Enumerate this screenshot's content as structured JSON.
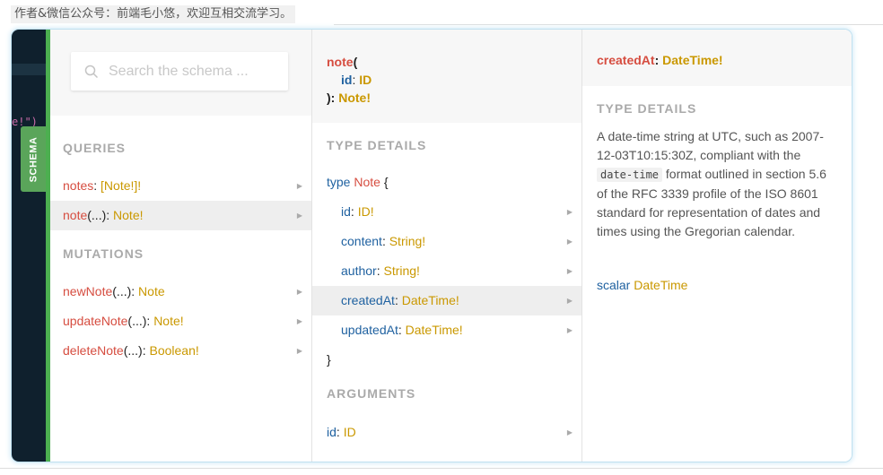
{
  "caption": "作者&微信公众号：前端毛小悠，欢迎互相交流学习。",
  "editor": {
    "code_fragment": "e!\")"
  },
  "schema_tab": "SCHEMA",
  "search": {
    "placeholder": "Search the schema ..."
  },
  "explorer": {
    "queries_title": "QUERIES",
    "queries": [
      {
        "name": "notes",
        "args": "",
        "sep": ": ",
        "type": "[Note!]!"
      },
      {
        "name": "note",
        "args": "(...)",
        "sep": ": ",
        "type": "Note!"
      }
    ],
    "mutations_title": "MUTATIONS",
    "mutations": [
      {
        "name": "newNote",
        "args": "(...)",
        "sep": ": ",
        "type": "Note"
      },
      {
        "name": "updateNote",
        "args": "(...)",
        "sep": ": ",
        "type": "Note!"
      },
      {
        "name": "deleteNote",
        "args": "(...)",
        "sep": ": ",
        "type": "Boolean!"
      }
    ]
  },
  "detail": {
    "header": {
      "name": "note",
      "open": "(",
      "arg_name": "id",
      "arg_sep": ": ",
      "arg_type": "ID",
      "close": "): ",
      "return_type": "Note!"
    },
    "type_details_title": "TYPE DETAILS",
    "type_keyword": "type",
    "type_name": "Note",
    "open_brace": "{",
    "close_brace": "}",
    "fields": [
      {
        "name": "id",
        "sep": ": ",
        "type": "ID!"
      },
      {
        "name": "content",
        "sep": ": ",
        "type": "String!"
      },
      {
        "name": "author",
        "sep": ": ",
        "type": "String!"
      },
      {
        "name": "createdAt",
        "sep": ": ",
        "type": "DateTime!"
      },
      {
        "name": "updatedAt",
        "sep": ": ",
        "type": "DateTime!"
      }
    ],
    "arguments_title": "ARGUMENTS",
    "arguments": [
      {
        "name": "id",
        "sep": ": ",
        "type": "ID"
      }
    ]
  },
  "field_detail": {
    "name": "createdAt",
    "sep": ": ",
    "type": "DateTime!",
    "type_details_title": "TYPE DETAILS",
    "desc_before": "A date-time string at UTC, such as 2007-12-03T10:15:30Z, compliant with the ",
    "desc_code": "date-time",
    "desc_after": " format outlined in section 5.6 of the RFC 3339 profile of the ISO 8601 standard for representation of dates and times using the Gregorian calendar.",
    "scalar_keyword": "scalar",
    "scalar_type": "DateTime"
  },
  "arrow_glyph": "▶",
  "colors": {
    "field_name": "#d64d40",
    "type": "#ca9800",
    "keyword": "#1f61a0",
    "schema_tab": "#5aa55a",
    "editor_bg": "#0f202d"
  }
}
